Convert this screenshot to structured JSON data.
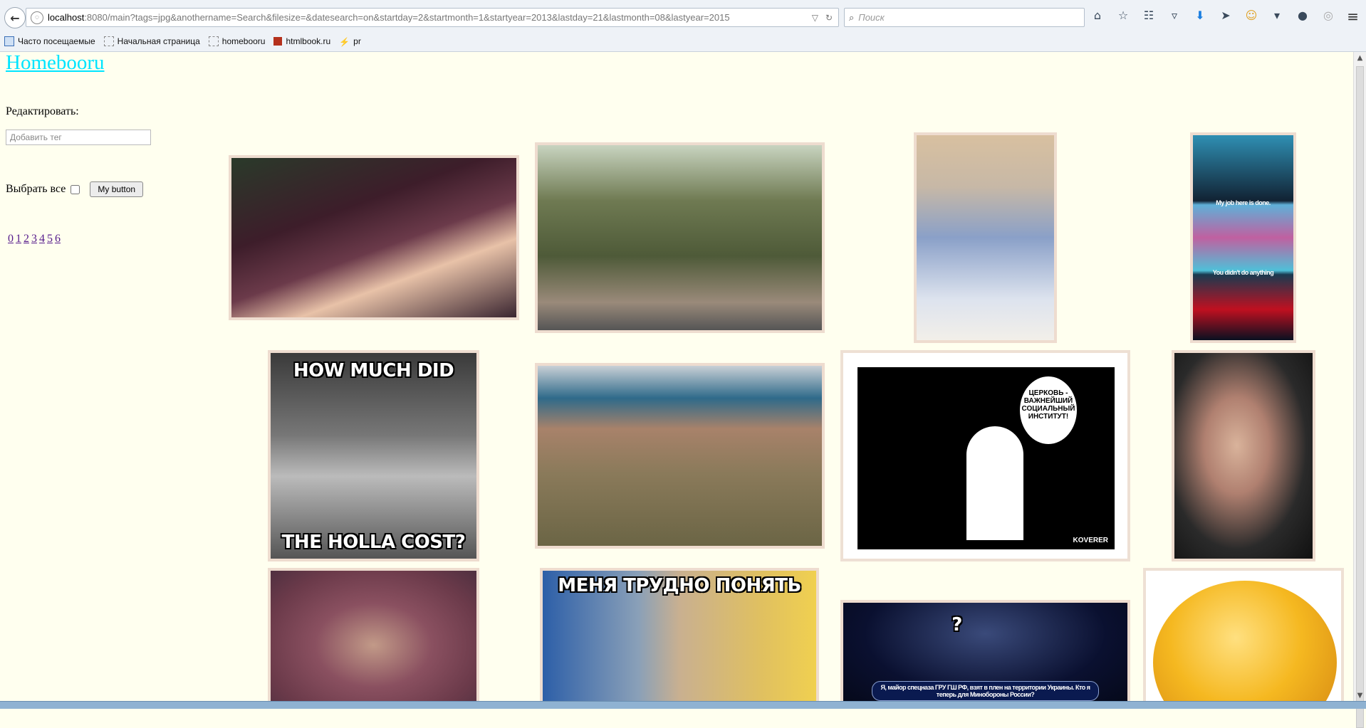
{
  "browser": {
    "url_host": "localhost",
    "url_rest": ":8080/main?tags=jpg&anothername=Search&filesize=&datesearch=on&startday=2&startmonth=1&startyear=2013&lastday=21&lastmonth=08&lastyear=2015",
    "search_placeholder": "Поиск",
    "bookmarks": [
      {
        "label": "Часто посещаемые",
        "icon": "folder-icon"
      },
      {
        "label": "Начальная страница",
        "icon": "page-icon"
      },
      {
        "label": "homebooru",
        "icon": "page-icon"
      },
      {
        "label": "htmlbook.ru",
        "icon": "site-icon"
      },
      {
        "label": "pr",
        "icon": "bolt-icon"
      }
    ]
  },
  "page": {
    "site_title": "Homebooru",
    "edit_label": "Редактировать:",
    "tag_placeholder": "Добавить тег",
    "select_all_label": "Выбрать все",
    "my_button_label": "My button",
    "pages": [
      "0",
      "1",
      "2",
      "3",
      "4",
      "5",
      "6"
    ]
  },
  "tiles": [
    {
      "name": "anime-girl-image"
    },
    {
      "name": "parade-strollers-image"
    },
    {
      "name": "kimono-girls-image"
    },
    {
      "name": "sailor-moon-comic-image",
      "text_top": "My job here is done.",
      "text_mid": "You didn't do anything"
    },
    {
      "name": "meme-hitler-image",
      "text_top": "HOW MUCH DID",
      "text_bottom": "THE HOLLA COST?"
    },
    {
      "name": "soldiers-laughing-image"
    },
    {
      "name": "cartoon-church-image",
      "text_bubble": "ЦЕРКОВЬ - ВАЖНЕЙШИЙ СОЦИАЛЬНЫЙ ИНСТИТУТ!",
      "signature": "KOVERER"
    },
    {
      "name": "dawkins-portrait-image"
    },
    {
      "name": "eyeroll-man-image"
    },
    {
      "name": "klitschko-meme-image",
      "text_top": "МЕНЯ ТРУДНО ПОНЯТЬ"
    },
    {
      "name": "quiz-show-image",
      "text_question": "?",
      "text_bottom": "Я, майор спецназа ГРУ ГШ РФ, взят в плен на территории Украины. Кто я теперь для Минобороны России?"
    },
    {
      "name": "kolobok-face-image"
    }
  ]
}
